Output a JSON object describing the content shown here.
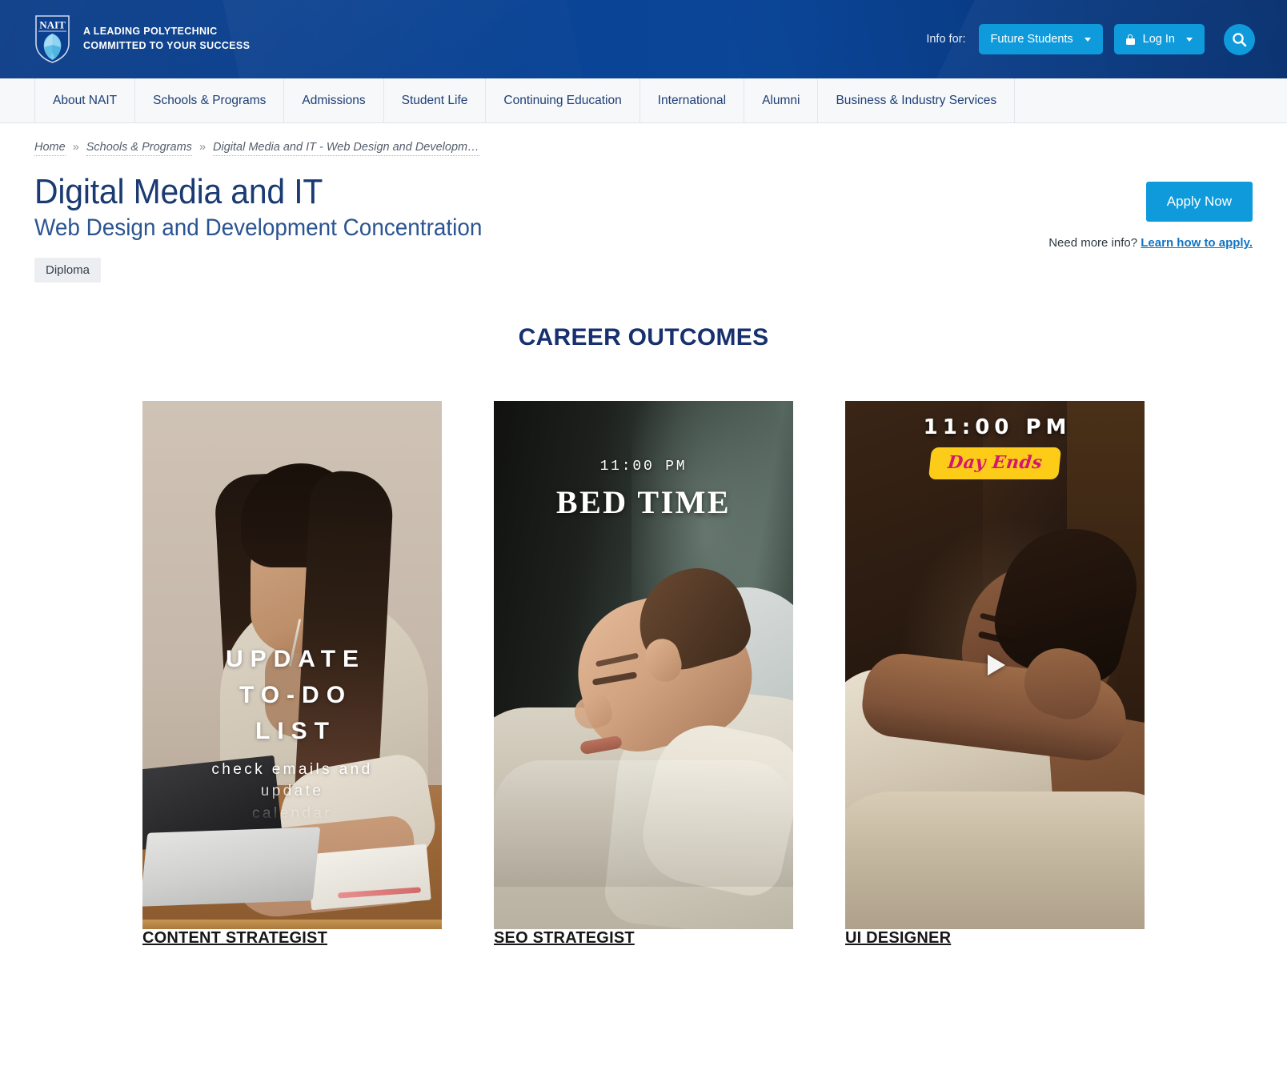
{
  "topbar": {
    "logo_alt": "NAIT",
    "logo_wordmark": "NAIT",
    "tagline_line1": "A LEADING POLYTECHNIC",
    "tagline_line2": "COMMITTED TO YOUR SUCCESS",
    "info_for_label": "Info for:",
    "audience_selected": "Future Students",
    "login_label": "Log In",
    "search_icon": "search-icon",
    "accent_color": "#0f9bdb",
    "bar_color": "#0b4394"
  },
  "mainnav": {
    "items": [
      {
        "label": "About NAIT"
      },
      {
        "label": "Schools & Programs"
      },
      {
        "label": "Admissions"
      },
      {
        "label": "Student Life"
      },
      {
        "label": "Continuing Education"
      },
      {
        "label": "International"
      },
      {
        "label": "Alumni"
      },
      {
        "label": "Business & Industry Services"
      }
    ]
  },
  "breadcrumb": {
    "separator": "»",
    "items": [
      {
        "label": "Home"
      },
      {
        "label": "Schools & Programs"
      },
      {
        "label": "Digital Media and IT - Web Design and Developm…"
      }
    ]
  },
  "pagehead": {
    "title": "Digital Media and IT",
    "subtitle": "Web Design and Development Concentration",
    "credential_badge": "Diploma",
    "apply_button": "Apply Now",
    "need_info_text": "Need more info?",
    "learn_link": "Learn how to apply.",
    "title_color": "#1a3a72"
  },
  "career_outcomes": {
    "section_title": "CAREER OUTCOMES",
    "cards": [
      {
        "caption": "CONTENT STRATEGIST",
        "overlay_headline_line1": "UPDATE",
        "overlay_headline_line2": "TO-DO",
        "overlay_headline_line3": "LIST",
        "overlay_sub_line1": "check emails and",
        "overlay_sub_line2": "update",
        "overlay_sub_line3": "calendar",
        "has_play_button": false
      },
      {
        "caption": "SEO STRATEGIST",
        "overlay_time": "11:00 PM",
        "overlay_title": "BED TIME",
        "has_play_button": false
      },
      {
        "caption": "UI DESIGNER",
        "overlay_time": "11:00 PM",
        "overlay_badge": "Day Ends",
        "badge_bg": "#fccc18",
        "badge_text_color": "#d3186f",
        "has_play_button": true,
        "play_icon": "play-icon"
      }
    ]
  }
}
